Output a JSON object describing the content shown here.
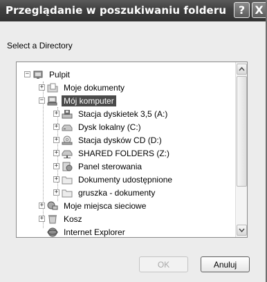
{
  "window": {
    "title": "Przeglądanie w poszukiwaniu folderu",
    "help_label": "?",
    "close_label": "X"
  },
  "prompt": "Select a Directory",
  "tree": {
    "items": [
      {
        "label": "Pulpit",
        "icon": "desktop-icon",
        "expander": "−"
      },
      {
        "label": "Moje dokumenty",
        "icon": "folder-documents-icon",
        "expander": "+"
      },
      {
        "label": "Mój komputer",
        "icon": "computer-icon",
        "expander": "−",
        "selected": true
      },
      {
        "label": "Stacja dyskietek 3,5 (A:)",
        "icon": "floppy-drive-icon",
        "expander": "+"
      },
      {
        "label": "Dysk lokalny (C:)",
        "icon": "hard-drive-icon",
        "expander": "+"
      },
      {
        "label": "Stacja dysków CD (D:)",
        "icon": "cd-drive-icon",
        "expander": "+"
      },
      {
        "label": "SHARED FOLDERS (Z:)",
        "icon": "network-drive-icon",
        "expander": "+"
      },
      {
        "label": "Panel sterowania",
        "icon": "control-panel-icon",
        "expander": "+"
      },
      {
        "label": "Dokumenty udostępnione",
        "icon": "folder-icon",
        "expander": "+"
      },
      {
        "label": "gruszka - dokumenty",
        "icon": "folder-icon",
        "expander": "+"
      },
      {
        "label": "Moje miejsca sieciowe",
        "icon": "network-places-icon",
        "expander": "+"
      },
      {
        "label": "Kosz",
        "icon": "recycle-bin-icon",
        "expander": "+"
      },
      {
        "label": "Internet Explorer",
        "icon": "internet-explorer-icon",
        "expander": ""
      }
    ]
  },
  "buttons": {
    "ok_label": "OK",
    "cancel_label": "Anuluj"
  }
}
